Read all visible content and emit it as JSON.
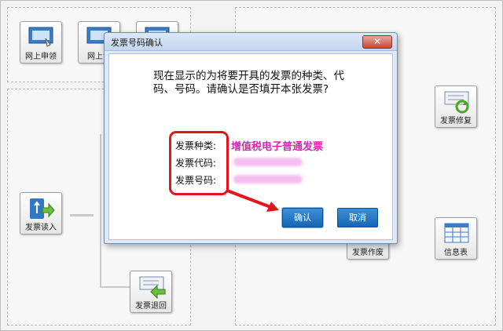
{
  "tiles": {
    "online_apply": "网上申领",
    "online_collect": "网上领",
    "invoice_read": "发票读入",
    "invoice_return": "发票退回",
    "invoice_repair": "发票修复",
    "invoice_void": "发票作废",
    "info_table": "信息表"
  },
  "dialog": {
    "title": "发票号码确认",
    "close_glyph": "✕",
    "prompt": "现在显示的为将要开具的发票的种类、代码、号码。请确认是否填开本张发票?",
    "type_label": "发票种类:",
    "type_value": "增值税电子普通发票",
    "code_label": "发票代码:",
    "number_label": "发票号码:",
    "confirm_label": "确认",
    "cancel_label": "取消"
  },
  "colors": {
    "highlight": "#e5131b",
    "type_value": "#e51fb8",
    "button": "#1f6fbf"
  }
}
